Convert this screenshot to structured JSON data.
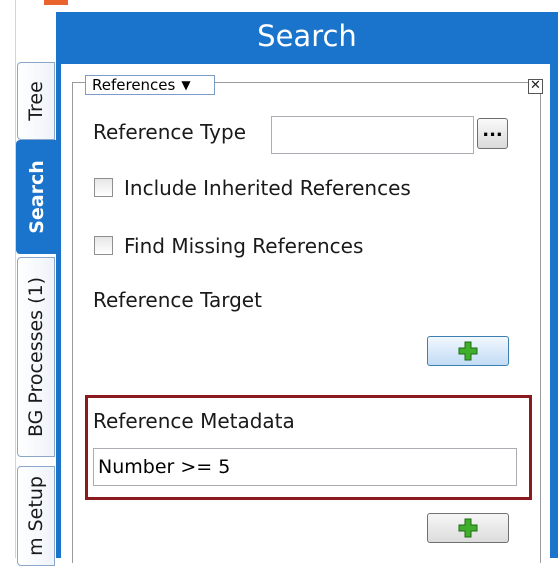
{
  "tabs": [
    {
      "label": "Tree",
      "active": false
    },
    {
      "label": "Search",
      "active": true
    },
    {
      "label": "BG Processes (1)",
      "active": false
    },
    {
      "label": "m Setup",
      "active": false
    }
  ],
  "panel": {
    "title": "Search",
    "dropdown_value": "References",
    "close_symbol": "✕"
  },
  "form": {
    "reference_type_label": "Reference Type",
    "reference_type_value": "",
    "ellipsis_label": "...",
    "include_inherited_label": "Include Inherited References",
    "include_inherited_checked": false,
    "find_missing_label": "Find Missing References",
    "find_missing_checked": false,
    "reference_target_label": "Reference Target",
    "reference_metadata_label": "Reference Metadata",
    "reference_metadata_value": "Number >= 5"
  },
  "colors": {
    "panel_blue": "#1a74cc",
    "highlight_red": "#8b1a1f",
    "plus_green": "#3fae2a"
  },
  "icons": {
    "add": "plus-icon",
    "dropdown": "caret-down-icon",
    "close": "close-icon"
  }
}
